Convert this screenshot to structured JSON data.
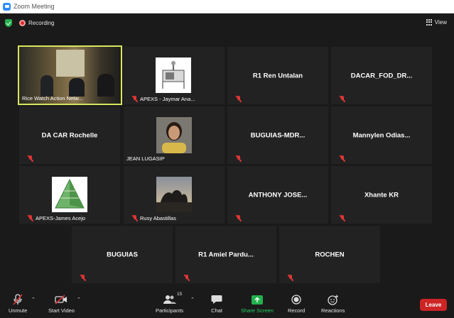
{
  "window": {
    "title": "Zoom Meeting"
  },
  "topbar": {
    "recording_label": "Recording",
    "view_label": "View"
  },
  "participants": [
    {
      "name": "Rice Watch Action Netw...",
      "muted": false,
      "label_type": "video",
      "active": true
    },
    {
      "name": "APEXS - Jaymar Ana...",
      "muted": true,
      "label_type": "picture"
    },
    {
      "name": "R1 Ren Untalan",
      "muted": true,
      "label_type": "center"
    },
    {
      "name": "DACAR_FOD_DR...",
      "muted": true,
      "label_type": "center"
    },
    {
      "name": "DA CAR Rochelle",
      "muted": true,
      "label_type": "center"
    },
    {
      "name": "JEAN LUGASIP",
      "muted": false,
      "label_type": "picture"
    },
    {
      "name": "BUGUIAS-MDR...",
      "muted": true,
      "label_type": "center"
    },
    {
      "name": "Mannylen  Odias...",
      "muted": true,
      "label_type": "center"
    },
    {
      "name": "APEXS-James Acejo",
      "muted": true,
      "label_type": "picture"
    },
    {
      "name": "Rusy Abastillas",
      "muted": true,
      "label_type": "picture"
    },
    {
      "name": "ANTHONY  JOSE...",
      "muted": true,
      "label_type": "center"
    },
    {
      "name": "Xhante KR",
      "muted": true,
      "label_type": "center"
    },
    {
      "name": "BUGUIAS",
      "muted": true,
      "label_type": "center"
    },
    {
      "name": "R1 Amiel Pardu...",
      "muted": true,
      "label_type": "center"
    },
    {
      "name": "ROCHEN",
      "muted": true,
      "label_type": "center"
    }
  ],
  "toolbar": {
    "unmute_label": "Unmute",
    "start_video_label": "Start Video",
    "participants_label": "Participants",
    "participants_count": "15",
    "chat_label": "Chat",
    "share_screen_label": "Share Screen",
    "record_label": "Record",
    "reactions_label": "Reactions",
    "leave_label": "Leave"
  },
  "colors": {
    "accent_share": "#23d160",
    "leave": "#cd2424",
    "active_speaker": "#d7e65e",
    "muted_icon": "#e03535"
  },
  "icons": [
    "zoom-logo-icon",
    "security-shield-icon",
    "recording-dot-icon",
    "grid-view-icon",
    "microphone-muted-icon",
    "video-off-icon",
    "participants-icon",
    "chat-icon",
    "share-screen-icon",
    "record-icon",
    "reactions-icon",
    "caret-up-icon"
  ]
}
